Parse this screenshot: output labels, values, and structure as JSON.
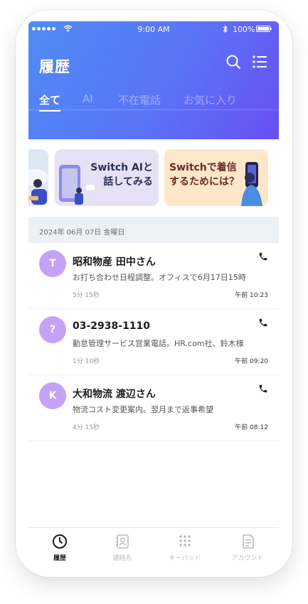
{
  "status_bar": {
    "time": "9:00 AM",
    "battery": "100%"
  },
  "header": {
    "title": "履歴"
  },
  "tabs": [
    {
      "label": "全て",
      "active": true
    },
    {
      "label": "AI",
      "active": false
    },
    {
      "label": "不在電話",
      "active": false
    },
    {
      "label": "お気に入り",
      "active": false
    }
  ],
  "banners": {
    "ai": {
      "line1": "Switch AIと",
      "line2": "話してみる"
    },
    "incoming": {
      "line1": "Switchで着信",
      "line2": "するためには？"
    }
  },
  "date_header": "2024年 06月 07日 金曜日",
  "calls": [
    {
      "avatar": "T",
      "name": "昭和物産 田中さん",
      "summary": "お打ち合わせ日程調整。オフィスで6月17日15時",
      "duration": "5分 15秒",
      "time": "午前 10:23"
    },
    {
      "avatar": "?",
      "name": "03-2938-1110",
      "summary": "勤怠管理サービス営業電話。HR.com社、鈴木様",
      "duration": "1分 10秒",
      "time": "午前 09:20"
    },
    {
      "avatar": "K",
      "name": "大和物流 渡辺さん",
      "summary": "物流コスト変更案内。翌月まで返事希望",
      "duration": "4分 15秒",
      "time": "午前 08:12"
    }
  ],
  "tabbar": [
    {
      "label": "履歴",
      "icon": "clock-icon",
      "active": true
    },
    {
      "label": "連絡先",
      "icon": "contacts-icon",
      "active": false
    },
    {
      "label": "キーパッド",
      "icon": "keypad-icon",
      "active": false
    },
    {
      "label": "アカウント",
      "icon": "account-icon",
      "active": false
    }
  ],
  "colors": {
    "header_gradient_start": "#4f8bf4",
    "header_gradient_end": "#6a4ff4",
    "avatar": "#c4a2f4",
    "date_header_bg": "#edf0f4"
  }
}
